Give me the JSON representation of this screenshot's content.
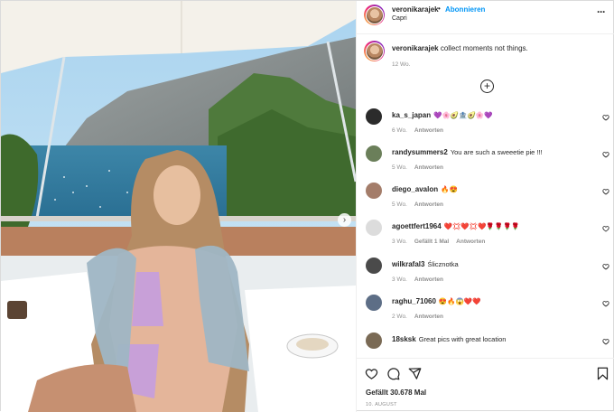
{
  "post": {
    "username": "veronikarajek",
    "separator": "•",
    "follow_label": "Abonnieren",
    "location": "Capri",
    "more_icon": "more-horizontal-icon",
    "caption_text": "collect moments not things.",
    "caption_time": "12 Wo.",
    "load_more_icon": "plus-circle-icon",
    "likes_label": "Gefällt 30.678 Mal",
    "date_label": "10. AUGUST"
  },
  "comments": [
    {
      "username": "ka_s_japan",
      "text": "💜🌸🥑🏦🥑🌸💜",
      "time": "6 Wo.",
      "likes": "",
      "reply": "Antworten",
      "avatar_color": "#2b2b2b"
    },
    {
      "username": "randysummers2",
      "text": "You are such a sweeetie pie !!!",
      "time": "5 Wo.",
      "likes": "",
      "reply": "Antworten",
      "avatar_color": "#6b7f5a"
    },
    {
      "username": "diego_avalon",
      "text": "🔥😍",
      "time": "5 Wo.",
      "likes": "",
      "reply": "Antworten",
      "avatar_color": "#a47d6a"
    },
    {
      "username": "agoettfert1964",
      "text": "❤️💢❤️💢❤️🌹🌹🌹🌹",
      "time": "3 Wo.",
      "likes": "Gefällt 1 Mal",
      "reply": "Antworten",
      "avatar_color": "#dcdcdc"
    },
    {
      "username": "wilkrafal3",
      "text": "Ślicznotka",
      "time": "3 Wo.",
      "likes": "",
      "reply": "Antworten",
      "avatar_color": "#4a4a4a"
    },
    {
      "username": "raghu_71060",
      "text": "😍🔥😱❤️❤️",
      "time": "2 Wo.",
      "likes": "",
      "reply": "Antworten",
      "avatar_color": "#5d6e86"
    },
    {
      "username": "18sksk",
      "text": "Great pics with great location",
      "time": "",
      "likes": "",
      "reply": "",
      "avatar_color": "#7a6a55"
    }
  ],
  "actions": {
    "like_icon": "heart-icon",
    "comment_icon": "comment-icon",
    "share_icon": "share-icon",
    "save_icon": "bookmark-icon"
  },
  "colors": {
    "follow_blue": "#0095f6",
    "muted": "#8e8e8e",
    "text": "#262626"
  }
}
